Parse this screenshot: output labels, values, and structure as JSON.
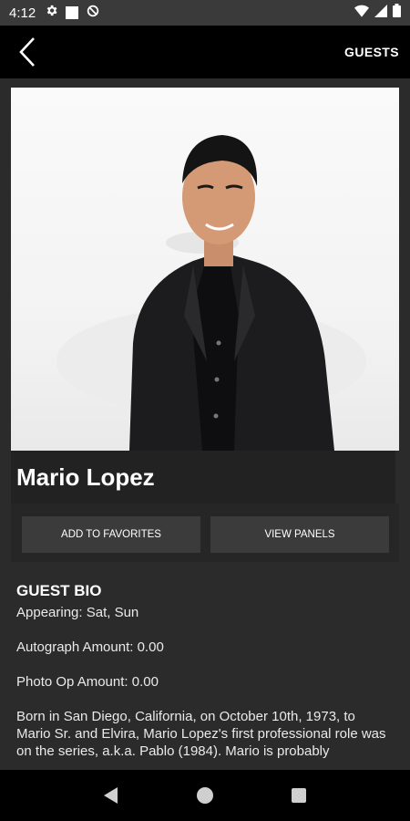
{
  "status_bar": {
    "time": "4:12",
    "icons": [
      "gear-icon",
      "square-icon",
      "data-saver-icon",
      "wifi-icon",
      "signal-icon",
      "battery-icon"
    ]
  },
  "app_bar": {
    "title": "GUESTS",
    "back_icon": "chevron-left-icon"
  },
  "guest": {
    "name": "Mario Lopez",
    "actions": {
      "add_to_favorites": "ADD TO FAVORITES",
      "view_panels": "VIEW PANELS"
    },
    "bio": {
      "heading": "GUEST BIO",
      "appearing": "Appearing: Sat, Sun",
      "autograph": "Autograph Amount: 0.00",
      "photo_op": "Photo Op Amount: 0.00",
      "text": "Born in San Diego, California, on October 10th, 1973, to Mario Sr. and Elvira, Mario Lopez's first professional role was on the series, a.k.a. Pablo (1984). Mario is probably"
    }
  },
  "nav_bar": {
    "items": [
      "back-triangle-icon",
      "home-circle-icon",
      "recents-square-icon"
    ]
  },
  "colors": {
    "background": "#2b2b2b",
    "app_bar": "#000000",
    "button": "#3b3b3b",
    "text": "#ffffff"
  }
}
